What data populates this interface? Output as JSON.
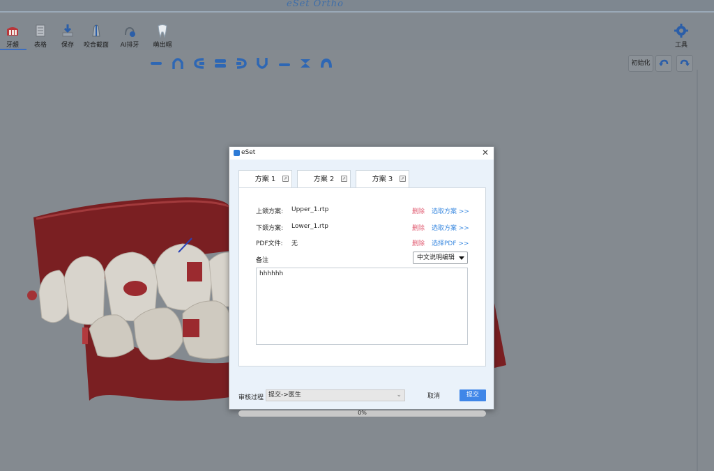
{
  "app": {
    "brand": "eSet Ortho"
  },
  "toolbar": {
    "items": [
      {
        "label": "牙龈",
        "icon": "gum-icon",
        "active": true
      },
      {
        "label": "表格",
        "icon": "table-icon",
        "active": false
      },
      {
        "label": "保存",
        "icon": "save-icon",
        "active": false
      },
      {
        "label": "咬合截面",
        "icon": "occlusal-section-icon",
        "active": false
      },
      {
        "label": "AI排牙",
        "icon": "ai-arrange-icon",
        "active": false
      },
      {
        "label": "萌出帽",
        "icon": "eruption-cap-icon",
        "active": false
      }
    ],
    "tools_label": "工具"
  },
  "view_controls": {
    "reset_label": "初始化",
    "undo_icon": "undo-icon",
    "redo_icon": "redo-icon"
  },
  "view_shapes": [
    "shape-dash",
    "shape-arch",
    "shape-left",
    "shape-double",
    "shape-right",
    "shape-u",
    "shape-lower",
    "shape-cross",
    "shape-top"
  ],
  "dialog": {
    "title": "eSet",
    "tabs": [
      {
        "label": "方案 1",
        "active": true
      },
      {
        "label": "方案 2",
        "active": false
      },
      {
        "label": "方案 3",
        "active": false
      }
    ],
    "rows": [
      {
        "label": "上颌方案:",
        "value": "Upper_1.rtp",
        "delete": "删除",
        "pick": "选取方案 >>"
      },
      {
        "label": "下颌方案:",
        "value": "Lower_1.rtp",
        "delete": "删除",
        "pick": "选取方案 >>"
      },
      {
        "label": "PDF文件:",
        "value": "无",
        "delete": "删除",
        "pick": "选择PDF >>"
      }
    ],
    "notes_label": "备注",
    "notes_dropdown": "中文说明编辑",
    "notes_text": "hhhhhh",
    "review_label": "审核过程",
    "review_value": "提交->医生",
    "cancel_label": "取消",
    "submit_label": "提交",
    "progress": {
      "percent": 0,
      "label": "0%"
    }
  },
  "colors": {
    "accent": "#3f86e8",
    "danger": "#e05a70",
    "link": "#3e8be0",
    "gum": "#8e2c2c",
    "tooth": "#d8d4cc"
  }
}
